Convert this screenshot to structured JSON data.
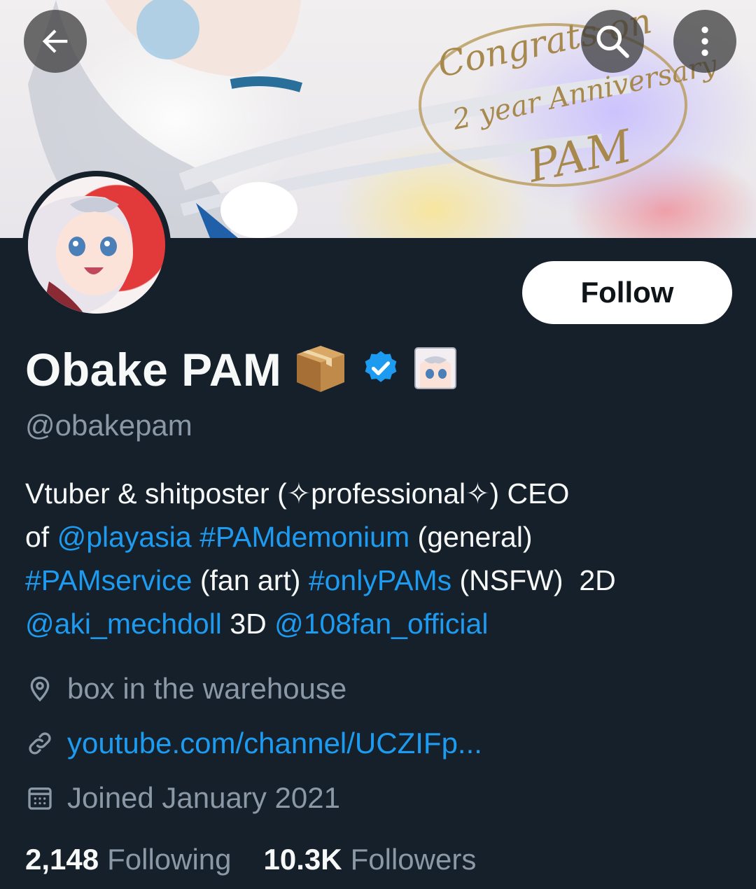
{
  "banner": {
    "text_lines": [
      "Congrats on",
      "2 year Anniversary",
      "PAM"
    ]
  },
  "header": {
    "back_icon": "arrow-left-icon",
    "search_icon": "search-icon",
    "more_icon": "more-vertical-icon"
  },
  "profile": {
    "follow_label": "Follow",
    "display_name": "Obake PAM",
    "name_badges": [
      "package-emoji",
      "verified-badge-icon",
      "avatar-emoji"
    ],
    "handle": "@obakepam",
    "bio": {
      "line1_text": "Vtuber & shitposter (✧professional✧) CEO",
      "line2_prefix": "of ",
      "line2_mention": "@playasia",
      "line2_hashtag": "#PAMdemonium",
      "line2_suffix": " (general)",
      "line3_hashtag1": "#PAMservice",
      "line3_mid": " (fan art) ",
      "line3_hashtag2": "#onlyPAMs",
      "line3_suffix": " (NSFW)  2D",
      "line4_mention1": "@aki_mechdoll",
      "line4_mid": " 3D ",
      "line4_mention2": "@108fan_official"
    },
    "location": "box in the warehouse",
    "website": "youtube.com/channel/UCZIFp...",
    "joined": "Joined January 2021",
    "following_count": "2,148",
    "following_label": "Following",
    "followers_count": "10.3K",
    "followers_label": "Followers"
  },
  "colors": {
    "background": "#15202b",
    "link": "#1d9bf0",
    "muted": "#8b98a5",
    "verified": "#1d9bf0"
  }
}
